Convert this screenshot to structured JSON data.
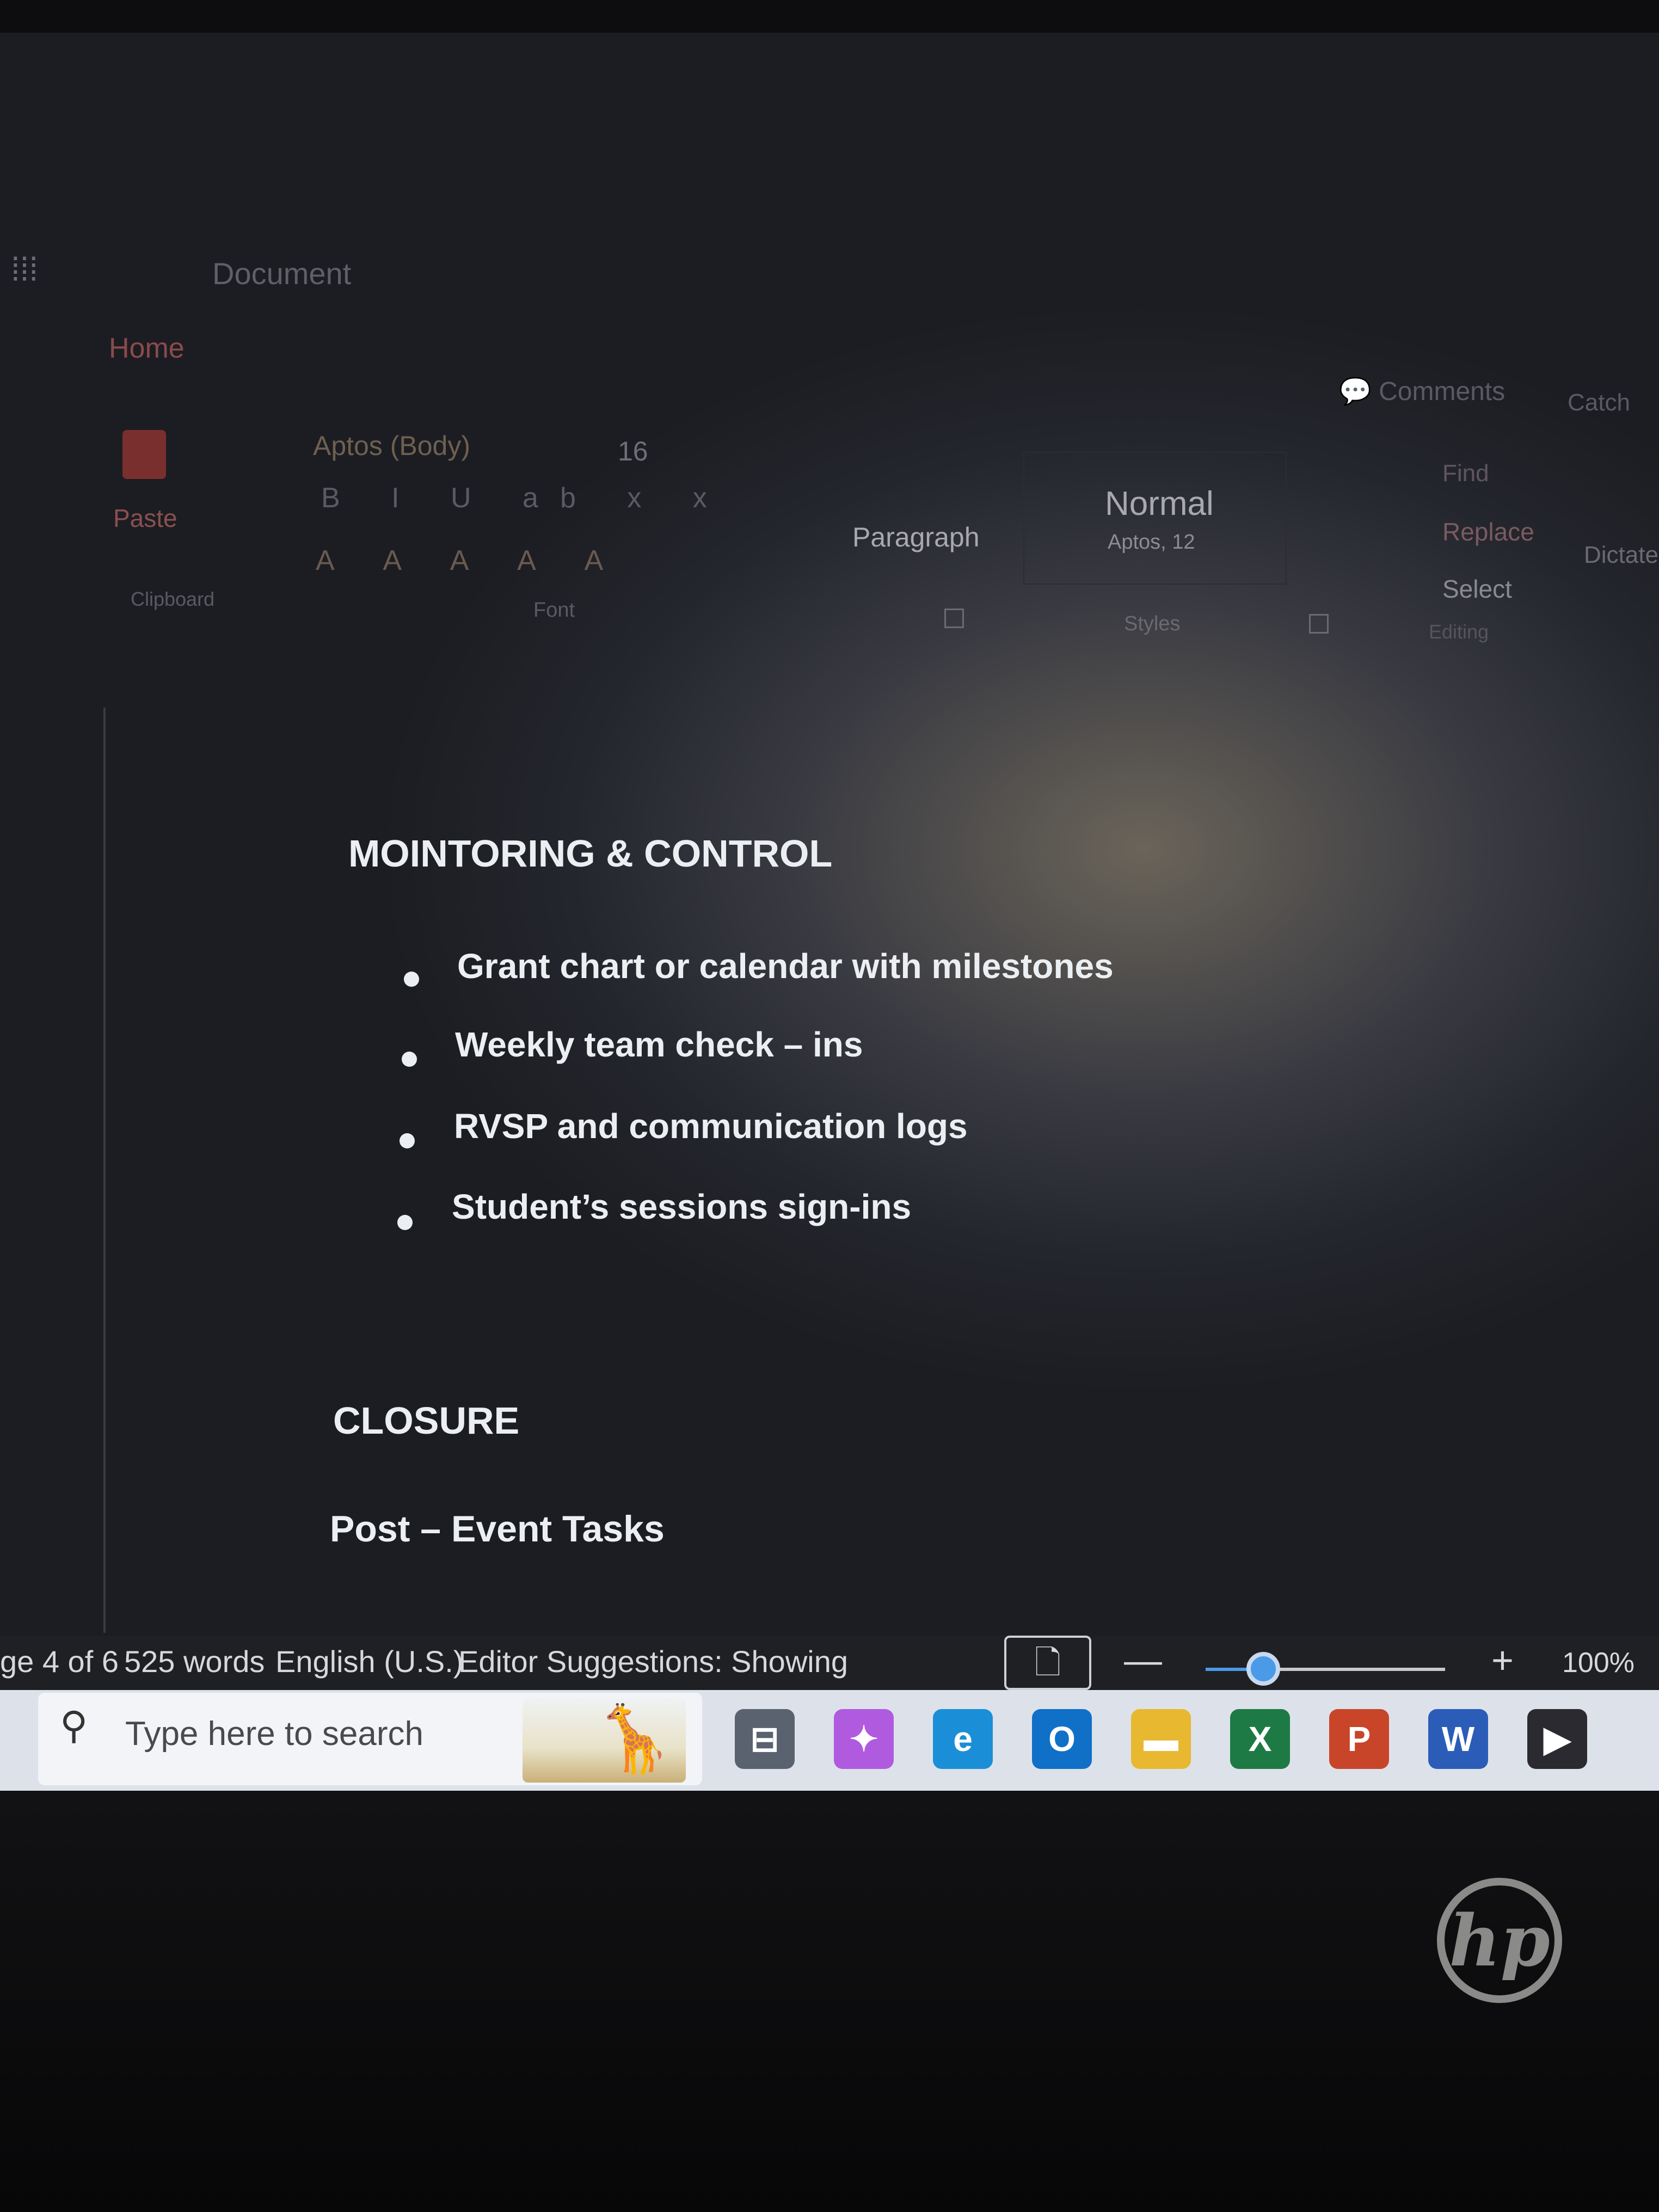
{
  "titlebar": {
    "waffle_glyph": "⁞⁞⁞",
    "doc_title": "Document"
  },
  "ribbon": {
    "tab_home": "Home",
    "comments": "Comments",
    "catch_up": "Catch",
    "paste": "Paste",
    "clipboard": "Clipboard",
    "font_name": "Aptos (Body)",
    "font_size": "16",
    "font_group": "Font",
    "format_row1": "B I U ab x x",
    "format_row2": "A A A A A",
    "paragraph": "Paragraph",
    "style_name": "Normal",
    "style_detail": "Aptos, 12",
    "styles_group": "Styles",
    "find": "Find",
    "replace": "Replace",
    "select": "Select",
    "editing_group": "Editing",
    "dictate": "Dictate"
  },
  "document": {
    "heading1": "MOINTORING & CONTROL",
    "bullets": [
      "Grant chart or calendar with milestones",
      "Weekly team check – ins",
      "RVSP and communication logs",
      "Student’s sessions sign-ins"
    ],
    "heading2": "CLOSURE",
    "subheading": "Post – Event Tasks"
  },
  "statusbar": {
    "page": "ge 4 of 6",
    "words": "525 words",
    "language": "English (U.S.)",
    "editor": "Editor Suggestions: Showing",
    "zoom_minus": "—",
    "zoom_plus": "+",
    "zoom_level": "100%",
    "zoom_fraction": 0.24
  },
  "taskbar": {
    "search_placeholder": "Type here to search",
    "apps": [
      {
        "name": "task-view",
        "glyph": "⊟",
        "color": "#5a6270"
      },
      {
        "name": "copilot",
        "glyph": "✦",
        "color": "#b05ae0"
      },
      {
        "name": "edge",
        "glyph": "e",
        "color": "#1a8fd8"
      },
      {
        "name": "outlook",
        "glyph": "O",
        "color": "#1070c8"
      },
      {
        "name": "file-explorer",
        "glyph": "▬",
        "color": "#e8b830"
      },
      {
        "name": "excel",
        "glyph": "X",
        "color": "#1d7a45"
      },
      {
        "name": "powerpoint",
        "glyph": "P",
        "color": "#c8452a"
      },
      {
        "name": "word",
        "glyph": "W",
        "color": "#2b5db8"
      },
      {
        "name": "media-player",
        "glyph": "▶",
        "color": "#2a2a30"
      }
    ]
  },
  "brand": {
    "logo_text": "hp"
  },
  "colors": {
    "accent": "#4a9ae8",
    "text": "#eceff2",
    "statusbar": "#1f2024"
  }
}
